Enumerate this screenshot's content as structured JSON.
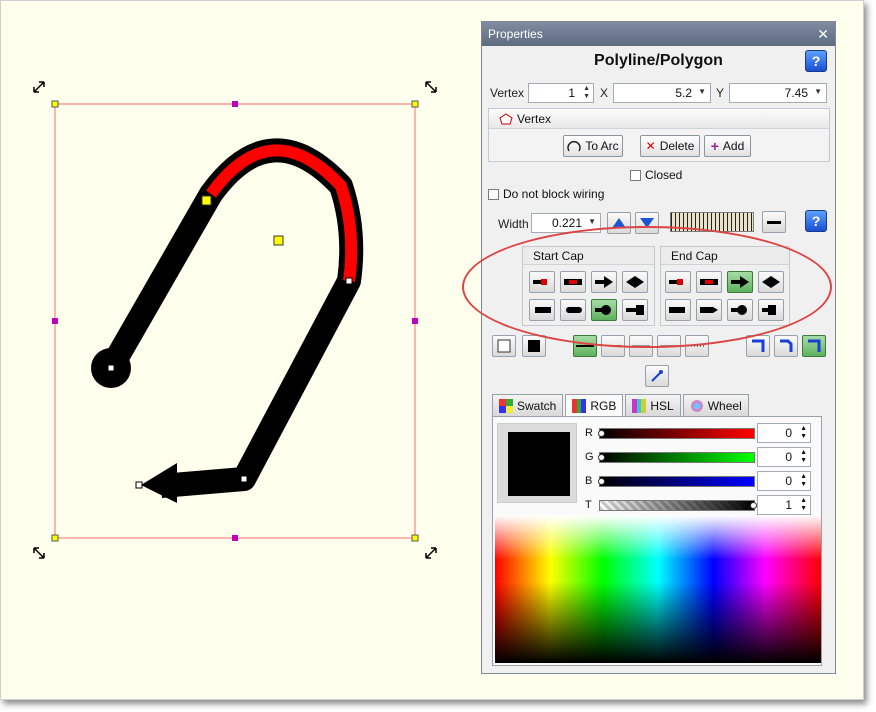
{
  "panel": {
    "window_title": "Properties",
    "heading": "Polyline/Polygon",
    "help": "?",
    "vertex_label": "Vertex",
    "vertex_value": "1",
    "x_label": "X",
    "x_value": "5.2",
    "y_label": "Y",
    "y_value": "7.45",
    "vertex_group_title": "Vertex",
    "to_arc": "To Arc",
    "delete": "Delete",
    "add": "Add",
    "closed": "Closed",
    "do_not_block": "Do not block wiring",
    "width_label": "Width",
    "width_value": "0.221",
    "start_cap": "Start Cap",
    "end_cap": "End Cap",
    "tabs": [
      "Swatch",
      "RGB",
      "HSL",
      "Wheel"
    ],
    "active_tab": "RGB",
    "sliders": [
      {
        "label": "R",
        "value": "0",
        "color": "#ff0000"
      },
      {
        "label": "G",
        "value": "0",
        "color": "#00ff00"
      },
      {
        "label": "B",
        "value": "0",
        "color": "#0000ff"
      },
      {
        "label": "T",
        "value": "1",
        "color": "#000000"
      }
    ],
    "selected_start_cap": "round",
    "selected_end_cap": "arrow",
    "line_color": "#000000",
    "highlight_color": "#ff0000"
  }
}
